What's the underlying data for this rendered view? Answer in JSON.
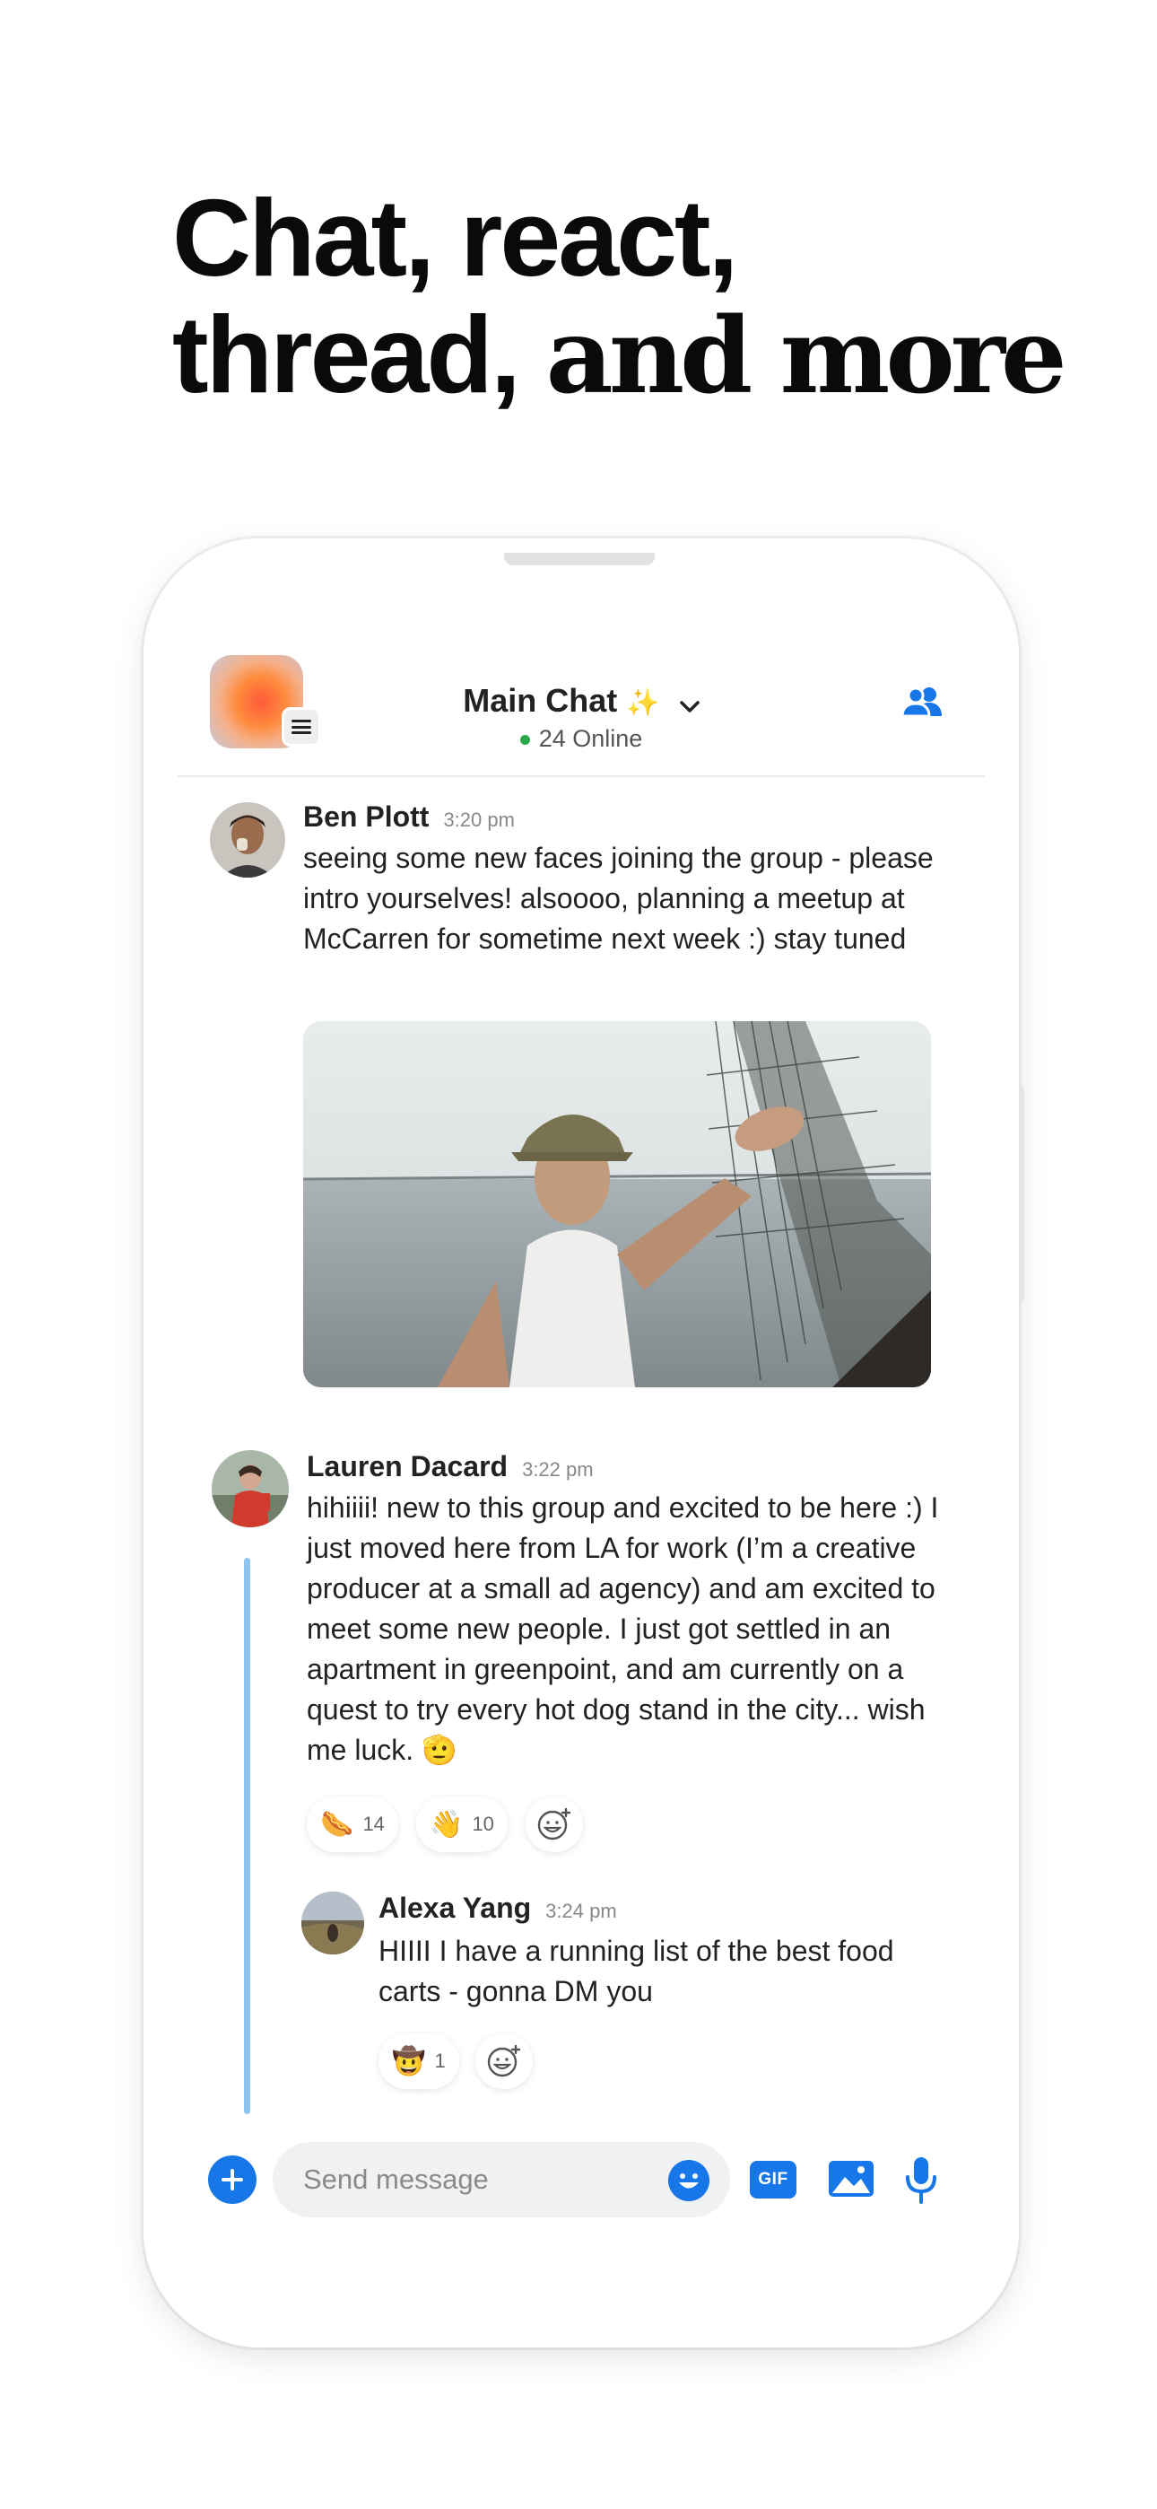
{
  "headline": {
    "line1": "Chat, react,",
    "line2_plain": "thread, ",
    "line2_serif": "and more"
  },
  "header": {
    "title": "Main Chat",
    "title_emoji": "✨",
    "online_text": "24 Online",
    "online_color": "#2aa84a",
    "accent_color": "#1877e8"
  },
  "messages": [
    {
      "author": "Ben Plott",
      "time": "3:20 pm",
      "text": "seeing some new faces joining the group - please intro yourselves! alsoooo, planning a meetup at McCarren for sometime next week :) stay tuned"
    },
    {
      "author": "Lauren Dacard",
      "time": "3:22 pm",
      "text": "hihiiii! new to this group and excited to be here :) I just moved here from LA for work (I’m a creative producer at a small ad agency) and am excited to meet some new people. I just got settled in an apartment in greenpoint, and am currently on a quest to try every hot dog stand in the city... wish me luck. 🫡",
      "reactions": [
        {
          "emoji": "🌭",
          "count": "14"
        },
        {
          "emoji": "👋",
          "count": "10"
        }
      ]
    }
  ],
  "thread_reply": {
    "author": "Alexa Yang",
    "time": "3:24 pm",
    "text": "HIIII I have a running list of the best food carts - gonna DM you",
    "reactions": [
      {
        "emoji": "🤠",
        "count": "1"
      }
    ]
  },
  "composer": {
    "placeholder": "Send message",
    "gif_label": "GIF"
  }
}
